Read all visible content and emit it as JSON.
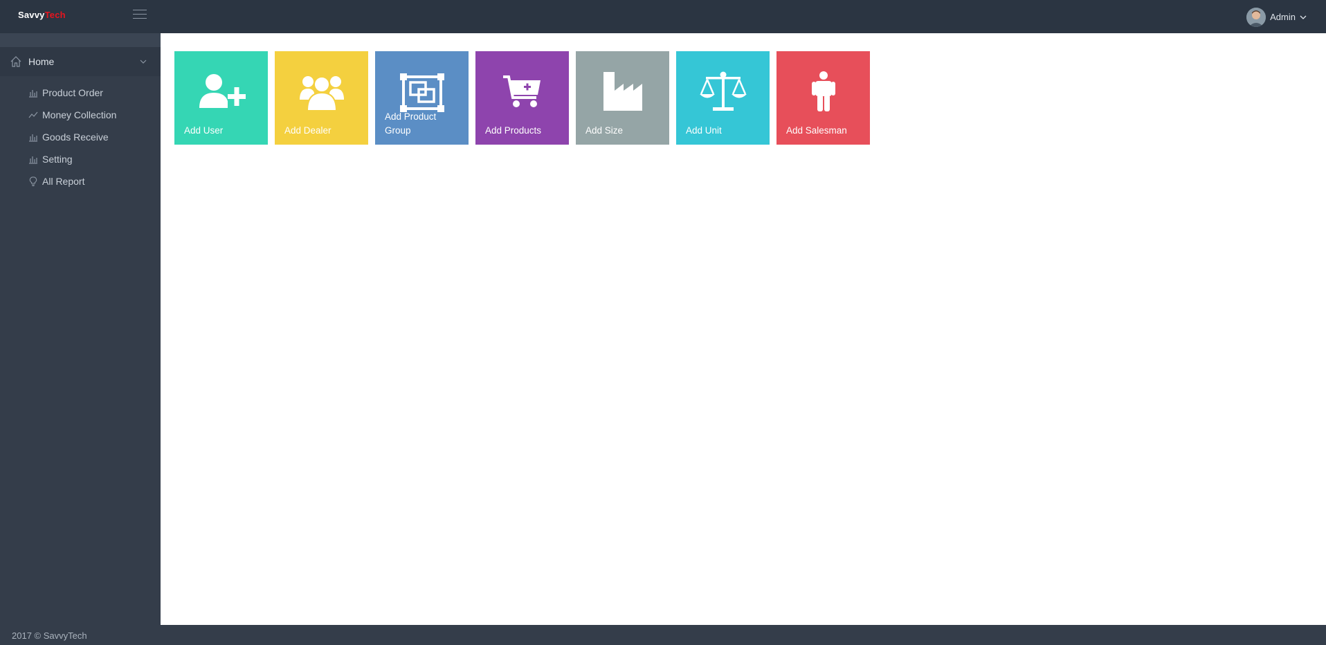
{
  "brand": {
    "part1": "Savvy",
    "part2": "Tech"
  },
  "header": {
    "user_name": "Admin"
  },
  "sidebar": {
    "home_label": "Home",
    "items": [
      {
        "label": "Product Order",
        "icon": "bar-chart-icon"
      },
      {
        "label": "Money Collection",
        "icon": "line-chart-icon"
      },
      {
        "label": "Goods Receive",
        "icon": "bar-chart-icon"
      },
      {
        "label": "Setting",
        "icon": "bar-chart-icon"
      },
      {
        "label": "All Report",
        "icon": "lightbulb-icon"
      }
    ]
  },
  "tiles": [
    {
      "label": "Add User",
      "icon": "add-user-icon",
      "color": "#35d6b4"
    },
    {
      "label": "Add Dealer",
      "icon": "users-group-icon",
      "color": "#f4d03f"
    },
    {
      "label": "Add Product Group",
      "icon": "object-group-icon",
      "color": "#5b8ec5"
    },
    {
      "label": "Add Products",
      "icon": "cart-plus-icon",
      "color": "#8e44ad"
    },
    {
      "label": "Add Size",
      "icon": "industry-icon",
      "color": "#95a5a6"
    },
    {
      "label": "Add Unit",
      "icon": "balance-scale-icon",
      "color": "#35c6d6"
    },
    {
      "label": "Add Salesman",
      "icon": "male-icon",
      "color": "#e74f5a"
    }
  ],
  "footer": {
    "text": "2017 © SavvyTech"
  }
}
